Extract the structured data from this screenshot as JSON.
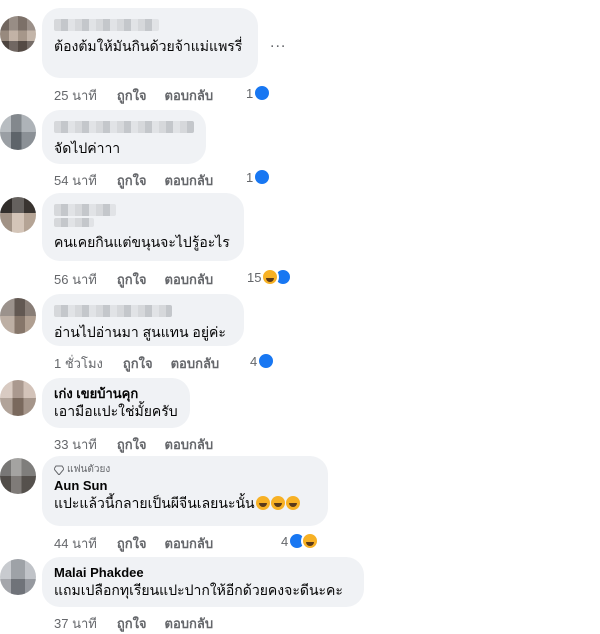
{
  "comments": [
    {
      "text": "ต้องต้มให้มันกินด้วยจ้าแม่แพรรี่",
      "time": "25 นาที",
      "like_label": "ถูกใจ",
      "reply_label": "ตอบกลับ",
      "reaction_count": "1",
      "reactions": [
        "like-icon"
      ]
    },
    {
      "text": "จัดไปค่าาา",
      "time": "54 นาที",
      "like_label": "ถูกใจ",
      "reply_label": "ตอบกลับ",
      "reaction_count": "1",
      "reactions": [
        "like-icon"
      ]
    },
    {
      "text": "คนเคยกินแต่ขนุนจะไปรู้อะไร",
      "time": "56 นาที",
      "like_label": "ถูกใจ",
      "reply_label": "ตอบกลับ",
      "reaction_count": "15",
      "reactions": [
        "haha-icon",
        "like-icon"
      ]
    },
    {
      "text": "อ่านไปอ่านมา สูนแทน อยู่ค่ะ",
      "time": "1 ชั่วโมง",
      "like_label": "ถูกใจ",
      "reply_label": "ตอบกลับ",
      "reaction_count": "4",
      "reactions": [
        "like-icon"
      ]
    },
    {
      "author": "เก่ง เขยบ้านคุก",
      "text": "เอามือแปะใช่มั้ยครับ",
      "time": "33 นาที",
      "like_label": "ถูกใจ",
      "reply_label": "ตอบกลับ"
    },
    {
      "badge": "แฟนตัวยง",
      "author": "Aun Sun",
      "text": "แปะแล้วนี้กลายเป็นผีจีนเลยนะนั้น",
      "time": "44 นาที",
      "like_label": "ถูกใจ",
      "reply_label": "ตอบกลับ",
      "reaction_count": "4",
      "reactions": [
        "like-icon",
        "haha-icon"
      ]
    },
    {
      "author": "Malai Phakdee",
      "text": "แถมเปลือกทุเรียนแปะปากให้อีกด้วยคงจะดีนะคะ",
      "time": "37 นาที",
      "like_label": "ถูกใจ",
      "reply_label": "ตอบกลับ"
    }
  ],
  "more_label": "...",
  "colors": {
    "bubble": "#f0f2f5",
    "meta_text": "#65676b",
    "like_blue": "#1877f2",
    "haha_yellow": "#f7b125"
  }
}
